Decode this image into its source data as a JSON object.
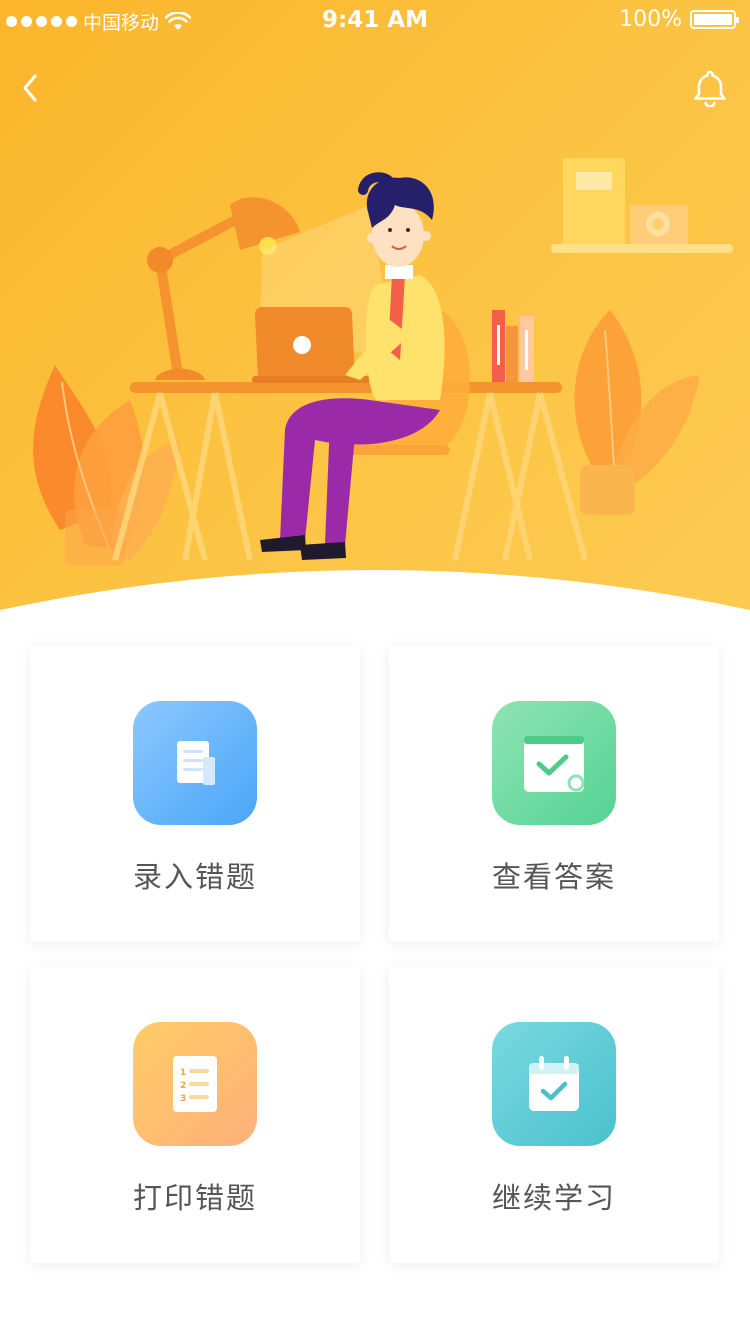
{
  "status_bar": {
    "carrier": "中国移动",
    "time": "9:41 AM",
    "battery": "100%"
  },
  "nav": {
    "back_icon": "chevron-left-icon",
    "bell_icon": "bell-icon"
  },
  "colors": {
    "hero_gradient_start": "#fbb62b",
    "hero_gradient_end": "#fdcb52",
    "card_text": "#555555"
  },
  "cards": [
    {
      "label": "录入错题",
      "icon": "document-icon",
      "color_start": "#8cc8ff",
      "color_end": "#4aa6f7"
    },
    {
      "label": "查看答案",
      "icon": "answer-book-icon",
      "color_start": "#8ee4b2",
      "color_end": "#55d394"
    },
    {
      "label": "打印错题",
      "icon": "numbered-list-icon",
      "color_start": "#ffcc66",
      "color_end": "#ffb07a"
    },
    {
      "label": "继续学习",
      "icon": "calendar-check-icon",
      "color_start": "#7ad9e0",
      "color_end": "#49c1cc"
    }
  ]
}
